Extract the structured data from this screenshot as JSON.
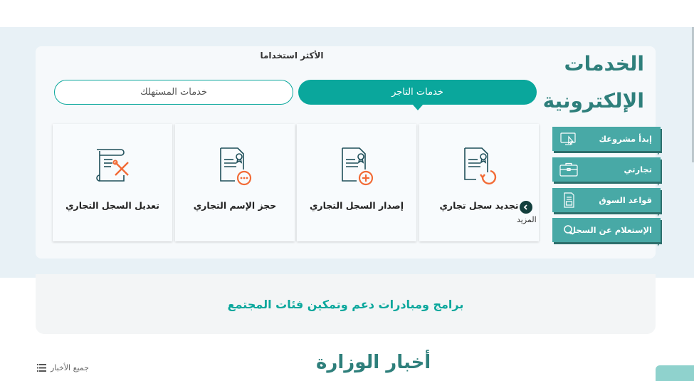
{
  "section_title": {
    "line1": "الخدمات",
    "line2": "الإلكترونية"
  },
  "most_used_label": "الأكثر استخداما",
  "tabs": [
    {
      "label": "خدمات التاجر",
      "active": true
    },
    {
      "label": "خدمات المستهلك",
      "active": false
    }
  ],
  "side_menu": [
    {
      "label": "إبدأ مشروعك",
      "icon": "cursor-screen-icon"
    },
    {
      "label": "تجارتي",
      "icon": "briefcase-icon"
    },
    {
      "label": "قواعد السوق",
      "icon": "document-grid-icon"
    },
    {
      "label": "الإستعلام عن السجل",
      "icon": "search-icon"
    }
  ],
  "services": [
    {
      "label": "تجديد سجل تجاري",
      "icon": "document-renew-icon"
    },
    {
      "label": "إصدار السجل التجاري",
      "icon": "document-add-icon"
    },
    {
      "label": "حجز الإسم التجاري",
      "icon": "document-reserve-icon"
    },
    {
      "label": "تعديل السجل التجاري",
      "icon": "scroll-tools-icon"
    }
  ],
  "more_label": "المزيد",
  "programs_banner": "برامج ومبادرات دعم وتمكين فئات المجتمع",
  "news": {
    "title": "أخبار الوزارة",
    "all_news_label": "جميع الأخبار"
  },
  "colors": {
    "accent": "#0aa79c",
    "title": "#2e7f7b",
    "side_button": "#48a9a6",
    "band": "#e8f1f6",
    "icon_dark": "#1f4f5a",
    "icon_accent": "#f26b36"
  }
}
